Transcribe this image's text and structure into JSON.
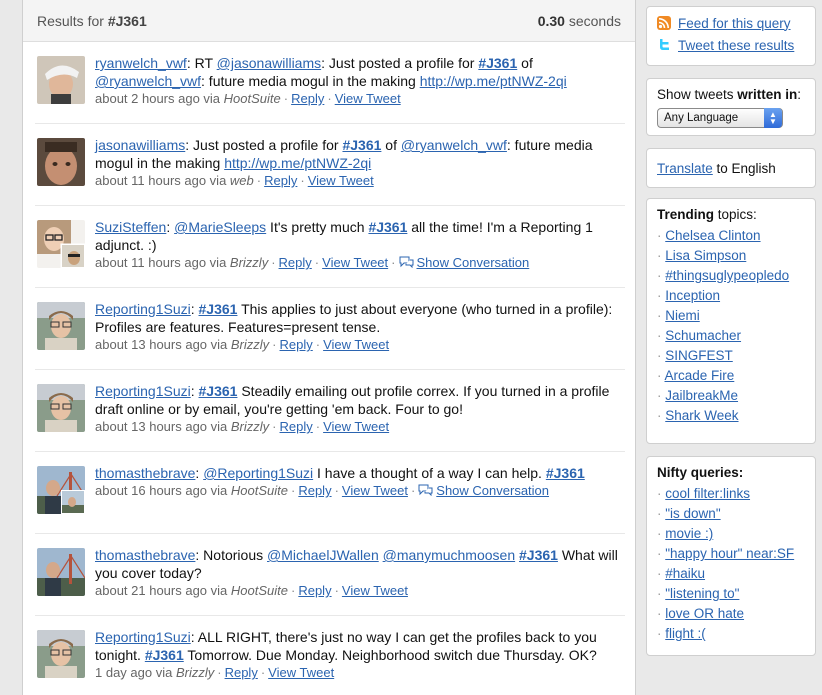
{
  "header": {
    "results_for": "Results for ",
    "query": "#J361",
    "seconds_value": "0.30",
    "seconds_label": " seconds"
  },
  "tweets": [
    {
      "user": "ryanwelch_vwf",
      "avatar": "photo-man-cap",
      "parts": [
        {
          "t": "link",
          "v": "ryanwelch_vwf"
        },
        {
          "t": "text",
          "v": ": RT "
        },
        {
          "t": "link",
          "v": "@jasonawilliams"
        },
        {
          "t": "text",
          "v": ": Just posted a profile for "
        },
        {
          "t": "tag",
          "v": "#J361"
        },
        {
          "t": "text",
          "v": " of "
        },
        {
          "t": "link",
          "v": "@ryanwelch_vwf"
        },
        {
          "t": "text",
          "v": ": future media mogul in the making "
        },
        {
          "t": "link",
          "v": "http://wp.me/ptNWZ-2qi"
        }
      ],
      "time": "about 2 hours ago via ",
      "source": "HootSuite",
      "reply": "Reply",
      "view": "View Tweet",
      "conversation": ""
    },
    {
      "user": "jasonawilliams",
      "avatar": "photo-man-closeup",
      "parts": [
        {
          "t": "link",
          "v": "jasonawilliams"
        },
        {
          "t": "text",
          "v": ": Just posted a profile for "
        },
        {
          "t": "tag",
          "v": "#J361"
        },
        {
          "t": "text",
          "v": " of "
        },
        {
          "t": "link",
          "v": "@ryanwelch_vwf"
        },
        {
          "t": "text",
          "v": ": future media mogul in the making "
        },
        {
          "t": "link",
          "v": "http://wp.me/ptNWZ-2qi"
        }
      ],
      "time": "about 11 hours ago via ",
      "source": "web",
      "reply": "Reply",
      "view": "View Tweet",
      "conversation": ""
    },
    {
      "user": "SuziSteffen",
      "avatar": "photo-woman-glasses",
      "parts": [
        {
          "t": "link",
          "v": "SuziSteffen"
        },
        {
          "t": "text",
          "v": ": "
        },
        {
          "t": "link",
          "v": "@MarieSleeps"
        },
        {
          "t": "text",
          "v": " It's pretty much "
        },
        {
          "t": "tag",
          "v": "#J361"
        },
        {
          "t": "text",
          "v": " all the time! I'm a Reporting 1 adjunct. :)"
        }
      ],
      "time": "about 11 hours ago via ",
      "source": "Brizzly",
      "reply": "Reply",
      "view": "View Tweet",
      "conversation": "Show Conversation"
    },
    {
      "user": "Reporting1Suzi",
      "avatar": "photo-woman-outdoor",
      "parts": [
        {
          "t": "link",
          "v": "Reporting1Suzi"
        },
        {
          "t": "text",
          "v": ": "
        },
        {
          "t": "tag",
          "v": "#J361"
        },
        {
          "t": "text",
          "v": " This applies to just about everyone (who turned in a profile): Profiles are features. Features=present tense."
        }
      ],
      "time": "about 13 hours ago via ",
      "source": "Brizzly",
      "reply": "Reply",
      "view": "View Tweet",
      "conversation": ""
    },
    {
      "user": "Reporting1Suzi",
      "avatar": "photo-woman-outdoor",
      "parts": [
        {
          "t": "link",
          "v": "Reporting1Suzi"
        },
        {
          "t": "text",
          "v": ": "
        },
        {
          "t": "tag",
          "v": "#J361"
        },
        {
          "t": "text",
          "v": " Steadily emailing out profile correx. If you turned in a profile draft online or by email, you're getting 'em back. Four to go!"
        }
      ],
      "time": "about 13 hours ago via ",
      "source": "Brizzly",
      "reply": "Reply",
      "view": "View Tweet",
      "conversation": ""
    },
    {
      "user": "thomasthebrave",
      "avatar": "photo-man-bridge",
      "parts": [
        {
          "t": "link",
          "v": "thomasthebrave"
        },
        {
          "t": "text",
          "v": ": "
        },
        {
          "t": "link",
          "v": "@Reporting1Suzi"
        },
        {
          "t": "text",
          "v": " I have a thought of a way I can help. "
        },
        {
          "t": "tag",
          "v": "#J361"
        }
      ],
      "time": "about 16 hours ago via ",
      "source": "HootSuite",
      "reply": "Reply",
      "view": "View Tweet",
      "conversation": "Show Conversation"
    },
    {
      "user": "thomasthebrave",
      "avatar": "photo-man-bridge",
      "parts": [
        {
          "t": "link",
          "v": "thomasthebrave"
        },
        {
          "t": "text",
          "v": ": Notorious "
        },
        {
          "t": "link",
          "v": "@MichaelJWallen"
        },
        {
          "t": "text",
          "v": " "
        },
        {
          "t": "link",
          "v": "@manymuchmoosen"
        },
        {
          "t": "text",
          "v": " "
        },
        {
          "t": "tag",
          "v": "#J361"
        },
        {
          "t": "text",
          "v": " What will you cover today?"
        }
      ],
      "time": "about 21 hours ago via ",
      "source": "HootSuite",
      "reply": "Reply",
      "view": "View Tweet",
      "conversation": ""
    },
    {
      "user": "Reporting1Suzi",
      "avatar": "photo-woman-outdoor",
      "parts": [
        {
          "t": "link",
          "v": "Reporting1Suzi"
        },
        {
          "t": "text",
          "v": ": ALL RIGHT, there's just no way I can get the profiles back to you tonight. "
        },
        {
          "t": "tag",
          "v": "#J361"
        },
        {
          "t": "text",
          "v": " Tomorrow. Due Monday. Neighborhood switch due Thursday. OK?"
        }
      ],
      "time": "1 day ago via ",
      "source": "Brizzly",
      "reply": "Reply",
      "view": "View Tweet",
      "conversation": ""
    }
  ],
  "sidebar": {
    "feed_label": "Feed for this query",
    "tweet_results_label": "Tweet these results",
    "lang_prefix": "Show tweets ",
    "lang_bold": "written in",
    "lang_suffix": ":",
    "lang_selected": "Any Language",
    "translate_link": "Translate",
    "translate_suffix": " to English",
    "trending_bold": "Trending",
    "trending_suffix": " topics:",
    "trending": [
      "Chelsea Clinton",
      "Lisa Simpson",
      "#thingsuglypeopledo",
      "Inception",
      "Niemi",
      "Schumacher",
      "SINGFEST",
      "Arcade Fire",
      "JailbreakMe",
      "Shark Week"
    ],
    "nifty_label": "Nifty queries:",
    "nifty": [
      "cool filter:links",
      "\"is down\"",
      "movie :)",
      "\"happy hour\" near:SF",
      "#haiku",
      "\"listening to\"",
      "love OR hate",
      "flight :("
    ]
  },
  "colors": {
    "link": "#2b64b0",
    "rss": "#f08a24",
    "twitter_bird": "#33ccff"
  }
}
